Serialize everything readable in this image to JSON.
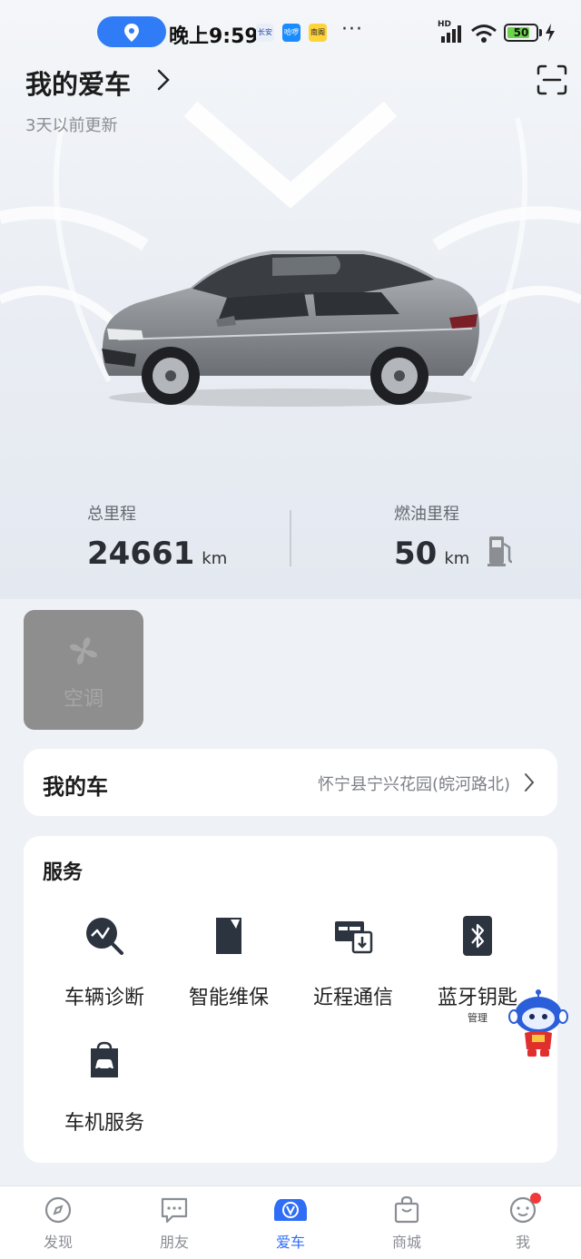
{
  "status_bar": {
    "time": "晚上9:59",
    "battery": "50",
    "network": "HD",
    "app_badges": [
      {
        "label": "长安",
        "color": "#e9eef8"
      },
      {
        "label": "哈啰",
        "color": "#1a8cff"
      },
      {
        "label": "南阁",
        "color": "#ffd33a"
      }
    ],
    "more": "···",
    "location_icon": "location-pin-icon"
  },
  "header": {
    "title": "我的爱车",
    "updated": "3天以前更新",
    "scan_icon": "scan-icon"
  },
  "stats": {
    "total_mileage_label": "总里程",
    "total_mileage_value": "24661",
    "total_mileage_unit": "km",
    "fuel_range_label": "燃油里程",
    "fuel_range_value": "50",
    "fuel_range_unit": "km"
  },
  "ac_tile": {
    "label": "空调",
    "icon": "fan-icon"
  },
  "my_car": {
    "title": "我的车",
    "location": "怀宁县宁兴花园(皖河路北)"
  },
  "services": {
    "title": "服务",
    "items": [
      {
        "label": "车辆诊断",
        "icon": "diagnosis-icon"
      },
      {
        "label": "智能维保",
        "icon": "maintenance-icon"
      },
      {
        "label": "近程通信",
        "icon": "nearfield-icon"
      },
      {
        "label": "蓝牙钥匙",
        "sub": "管理",
        "icon": "bluetooth-icon"
      },
      {
        "label": "车机服务",
        "icon": "car-service-icon"
      }
    ]
  },
  "tab_bar": {
    "tabs": [
      {
        "label": "发现",
        "icon": "compass-icon"
      },
      {
        "label": "朋友",
        "icon": "chat-icon"
      },
      {
        "label": "爱车",
        "icon": "car-tab-icon",
        "active": true
      },
      {
        "label": "商城",
        "icon": "bag-icon"
      },
      {
        "label": "我",
        "icon": "face-icon"
      }
    ]
  },
  "colors": {
    "accent": "#2f6df6",
    "icon_dark": "#2c3440",
    "notification": "#f03a3a"
  }
}
